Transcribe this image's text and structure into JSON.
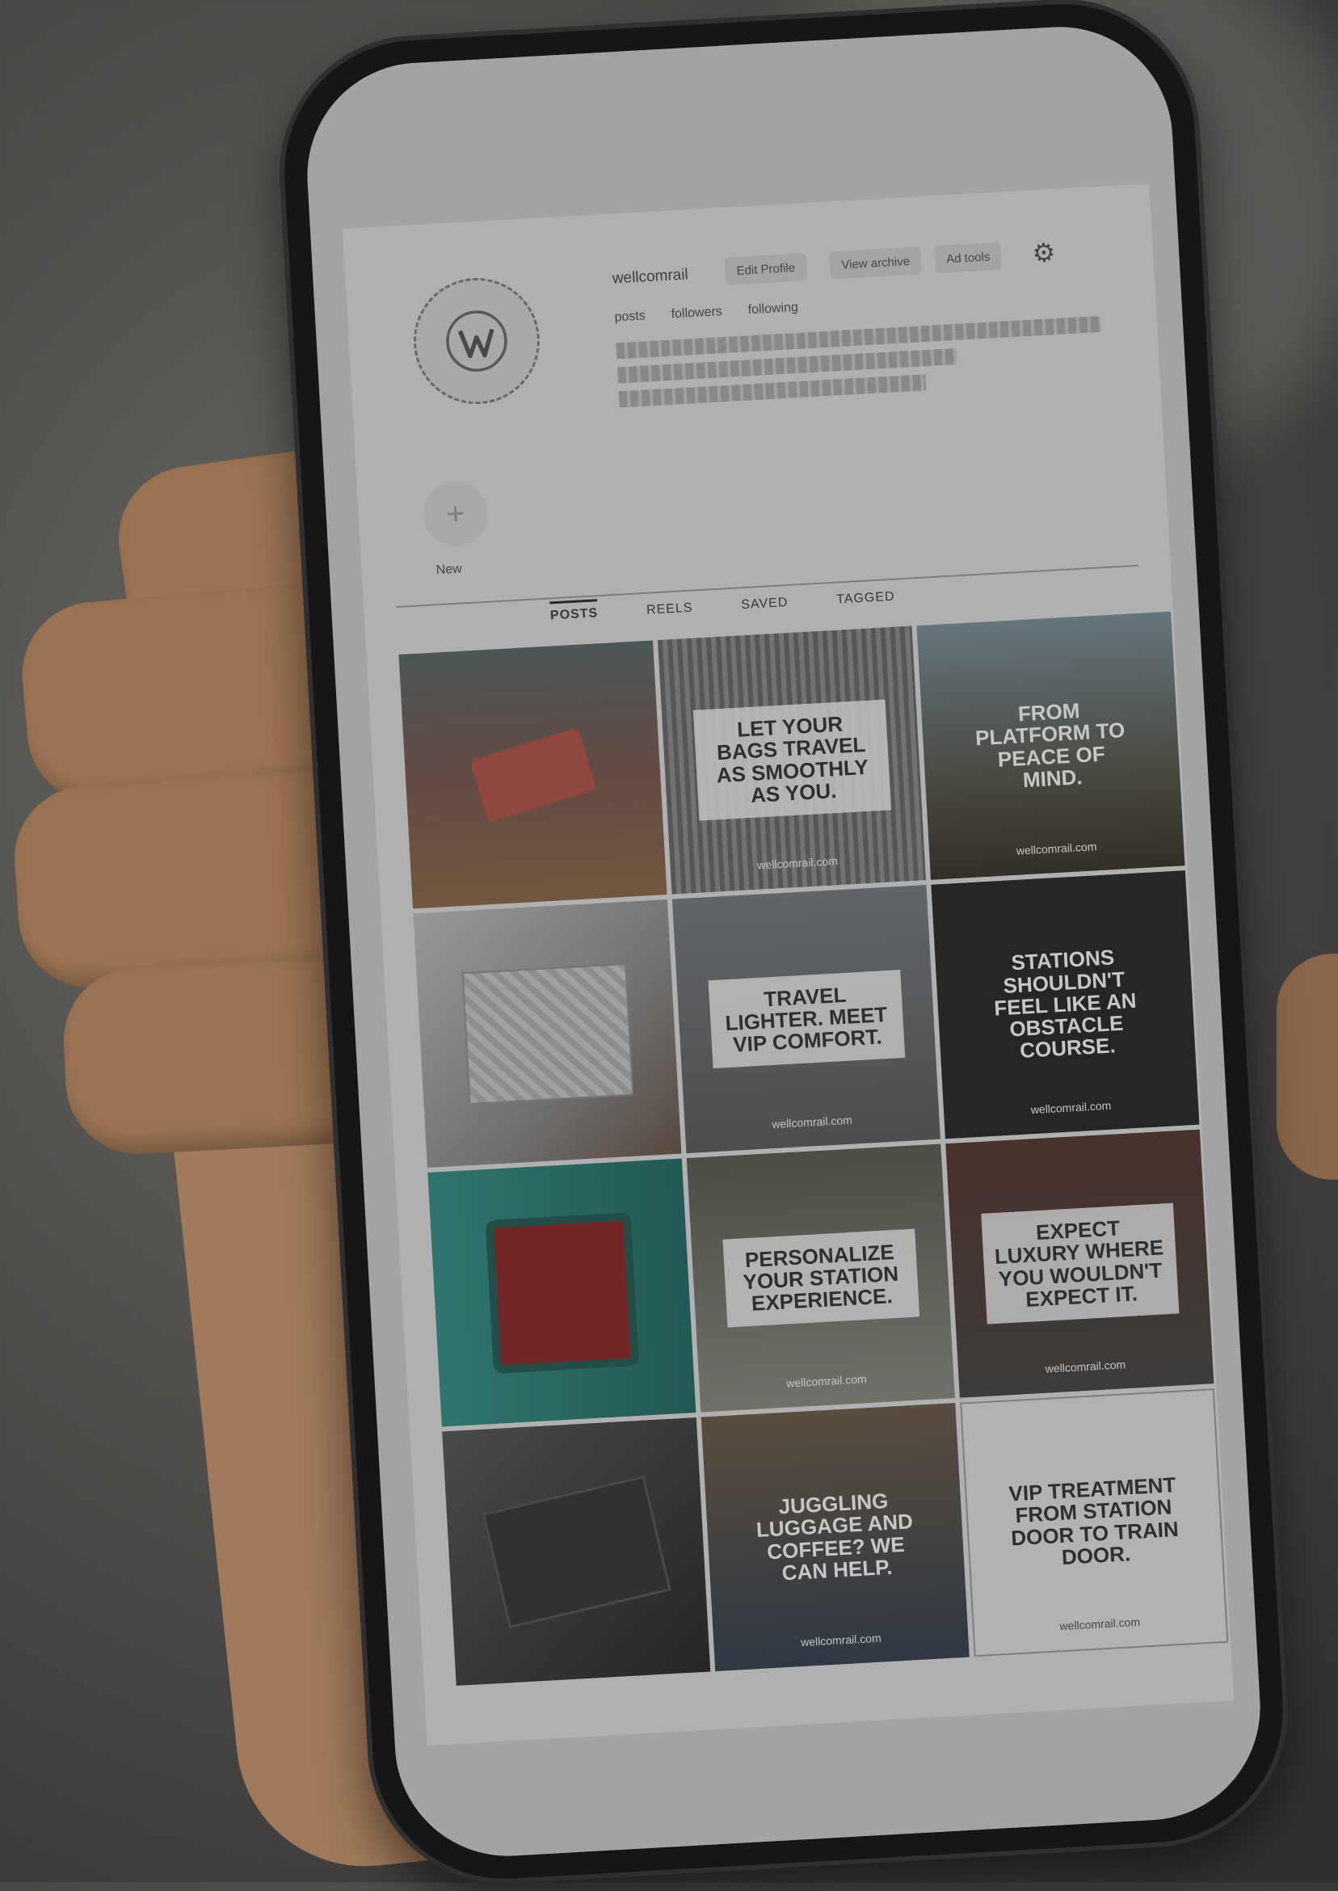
{
  "profile": {
    "username": "wellcomrail",
    "buttons": [
      "Edit Profile",
      "View archive",
      "Ad tools"
    ],
    "stats": [
      "posts",
      "followers",
      "following"
    ],
    "new_label": "New"
  },
  "tabs": [
    "POSTS",
    "REELS",
    "SAVED",
    "TAGGED"
  ],
  "posts": [
    {
      "text": "",
      "url": ""
    },
    {
      "text": "LET YOUR BAGS TRAVEL AS SMOOTHLY AS YOU.",
      "url": "wellcomrail.com"
    },
    {
      "text": "FROM PLATFORM TO PEACE OF MIND.",
      "url": "wellcomrail.com"
    },
    {
      "text": "",
      "url": ""
    },
    {
      "text": "TRAVEL LIGHTER. MEET VIP COMFORT.",
      "url": "wellcomrail.com"
    },
    {
      "text": "STATIONS SHOULDN'T FEEL LIKE AN OBSTACLE COURSE.",
      "url": "wellcomrail.com"
    },
    {
      "text": "",
      "url": ""
    },
    {
      "text": "PERSONALIZE YOUR STATION EXPERIENCE.",
      "url": "wellcomrail.com"
    },
    {
      "text": "EXPECT LUXURY WHERE YOU WOULDN'T EXPECT IT.",
      "url": "wellcomrail.com"
    },
    {
      "text": "",
      "url": ""
    },
    {
      "text": "JUGGLING LUGGAGE AND COFFEE? WE CAN HELP.",
      "url": "wellcomrail.com"
    },
    {
      "text": "VIP TREATMENT FROM STATION DOOR TO TRAIN DOOR.",
      "url": "wellcomrail.com"
    }
  ]
}
